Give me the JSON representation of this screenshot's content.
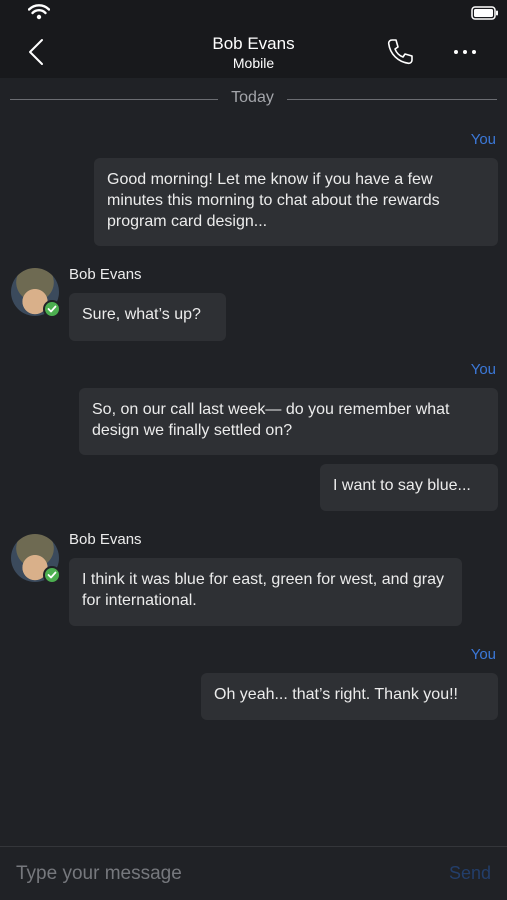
{
  "header": {
    "title": "Bob Evans",
    "subtitle": "Mobile"
  },
  "divider": {
    "label": "Today"
  },
  "messages": [
    {
      "label": "You",
      "text": "Good morning! Let me know if you have a few minutes this morning to chat about the rewards program card design..."
    },
    {
      "sender": "Bob Evans",
      "text": "Sure, what’s up?"
    },
    {
      "label": "You",
      "text": "So, on our call last week— do you remember what design we finally settled on?"
    },
    {
      "text": "I want to say blue..."
    },
    {
      "sender": "Bob Evans",
      "text": "I think it was blue for east, green for west, and gray for international."
    },
    {
      "label": "You",
      "text": "Oh yeah... that’s right. Thank you!!"
    }
  ],
  "composer": {
    "placeholder": "Type your message",
    "send_label": "Send"
  },
  "colors": {
    "background": "#202226",
    "bubble": "#2e3034",
    "accent": "#3b78d8",
    "presence": "#4caf50"
  },
  "icons": {
    "back": "chevron-left-icon",
    "call": "phone-icon",
    "more": "more-icon",
    "presence": "check-icon"
  }
}
